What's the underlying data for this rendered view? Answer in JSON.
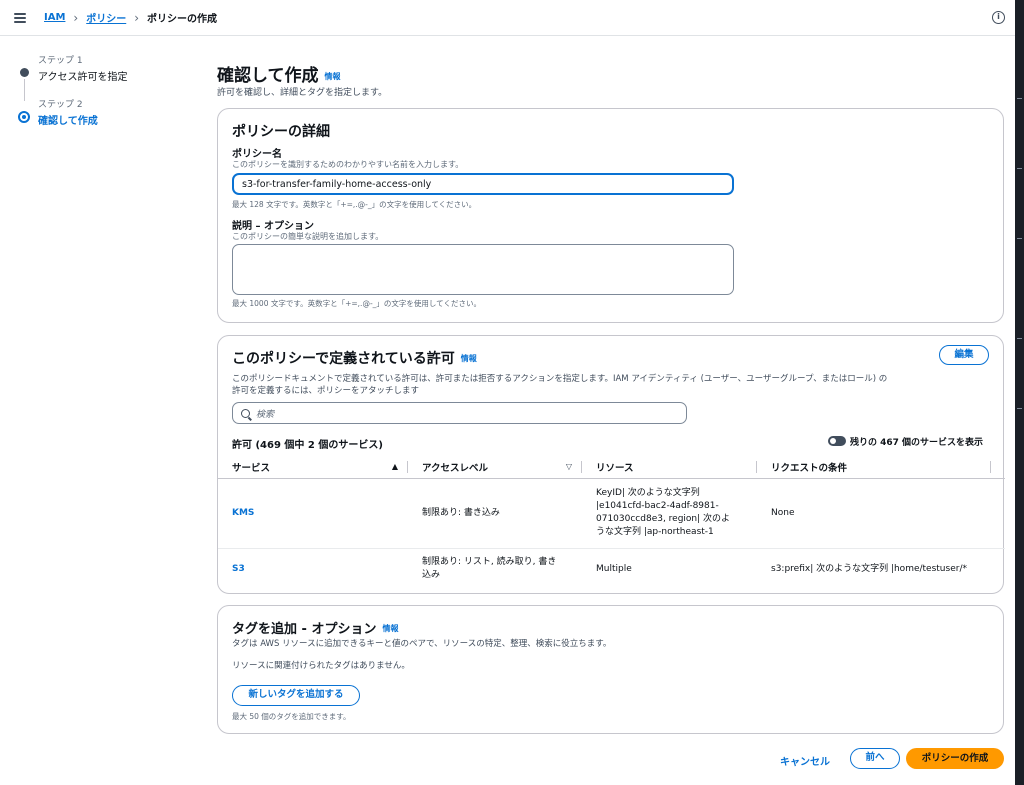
{
  "breadcrumb": {
    "items": [
      "IAM",
      "ポリシー"
    ],
    "current": "ポリシーの作成"
  },
  "steps": [
    {
      "num": "ステップ 1",
      "title": "アクセス許可を指定"
    },
    {
      "num": "ステップ 2",
      "title": "確認して作成"
    }
  ],
  "header": {
    "title": "確認して作成",
    "info": "情報",
    "subtitle": "許可を確認し、詳細とタグを指定します。"
  },
  "details": {
    "title": "ポリシーの詳細",
    "name_label": "ポリシー名",
    "name_desc": "このポリシーを識別するためのわかりやすい名前を入力します。",
    "name_value": "s3-for-transfer-family-home-access-only",
    "name_hint": "最大 128 文字です。英数字と「+=,.@-_」の文字を使用してください。",
    "desc_label": "説明 – オプション",
    "desc_desc": "このポリシーの簡単な説明を追加します。",
    "desc_value": "",
    "desc_hint": "最大 1000 文字です。英数字と「+=,.@-_」の文字を使用してください。"
  },
  "permissions": {
    "title": "このポリシーで定義されている許可",
    "info": "情報",
    "edit": "編集",
    "desc_line1": "このポリシードキュメントで定義されている許可は、許可または拒否するアクションを指定します。IAM アイデンティティ (ユーザー、ユーザーグループ、またはロール) の",
    "desc_line2": "許可を定義するには、ポリシーをアタッチします",
    "search_placeholder": "検索",
    "count": "許可 (469 個中 2 個のサービス)",
    "toggle_label": "残りの 467 個のサービスを表示",
    "columns": [
      "サービス",
      "アクセスレベル",
      "リソース",
      "リクエストの条件"
    ],
    "rows": [
      {
        "service": "KMS",
        "access": [
          "制限あり: 書き込み"
        ],
        "resource": [
          "KeyID| 次のような文字列",
          "|e1041cfd-bac2-4adf-8981-",
          "071030ccd8e3, region| 次のよ",
          "うな文字列 |ap-northeast-1"
        ],
        "condition": "None"
      },
      {
        "service": "S3",
        "access": [
          "制限あり: リスト, 読み取り, 書き",
          "込み"
        ],
        "resource": [
          "Multiple"
        ],
        "condition": "s3:prefix| 次のような文字列 |home/testuser/*"
      }
    ]
  },
  "tags": {
    "title": "タグを追加 - オプション",
    "info": "情報",
    "desc": "タグは AWS リソースに追加できるキーと値のペアで、リソースの特定、整理、検索に役立ちます。",
    "empty": "リソースに関連付けられたタグはありません。",
    "add_button": "新しいタグを追加する",
    "limit": "最大 50 個のタグを追加できます。"
  },
  "footer": {
    "cancel": "キャンセル",
    "previous": "前へ",
    "create": "ポリシーの作成"
  },
  "colors": {
    "accent": "#0972d3",
    "primary": "#ff9900"
  }
}
